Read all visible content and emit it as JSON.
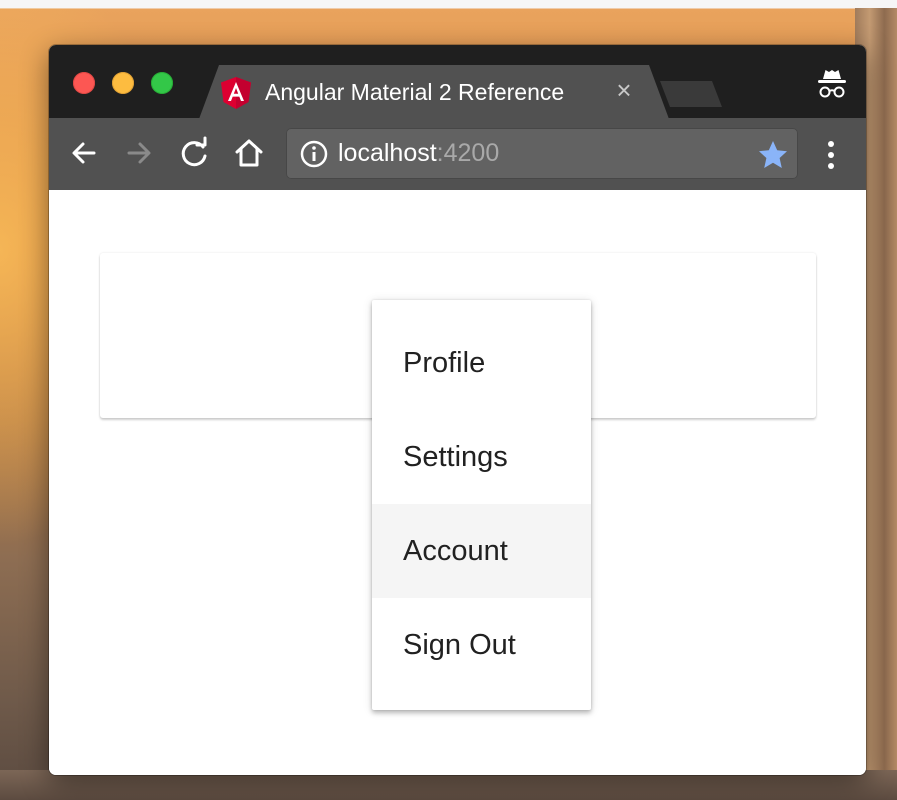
{
  "browser": {
    "tab": {
      "title": "Angular Material 2 Reference",
      "close_glyph": "×",
      "favicon": "angular-icon",
      "favicon_color": "#dd0031"
    },
    "incognito_icon": "incognito-icon",
    "toolbar": {
      "back_icon": "back-arrow-icon",
      "forward_icon": "forward-arrow-icon",
      "reload_icon": "reload-icon",
      "home_icon": "home-icon",
      "menu_icon": "more-vert-icon"
    },
    "omnibox": {
      "info_icon": "info-icon",
      "host": "localhost",
      "port": ":4200",
      "bookmark_icon": "star-icon",
      "bookmark_color": "#8ab4f8"
    }
  },
  "page": {
    "menu": {
      "items": [
        {
          "label": "Profile",
          "hovered": false
        },
        {
          "label": "Settings",
          "hovered": false
        },
        {
          "label": "Account",
          "hovered": true
        },
        {
          "label": "Sign Out",
          "hovered": false
        }
      ]
    }
  },
  "colors": {
    "tabstrip": "#1f1f1f",
    "toolbar": "#515151",
    "menu_hover": "#f5f5f5",
    "close_button": "#fc5753",
    "minimize_button": "#fdbc40",
    "maximize_button": "#33c748"
  }
}
